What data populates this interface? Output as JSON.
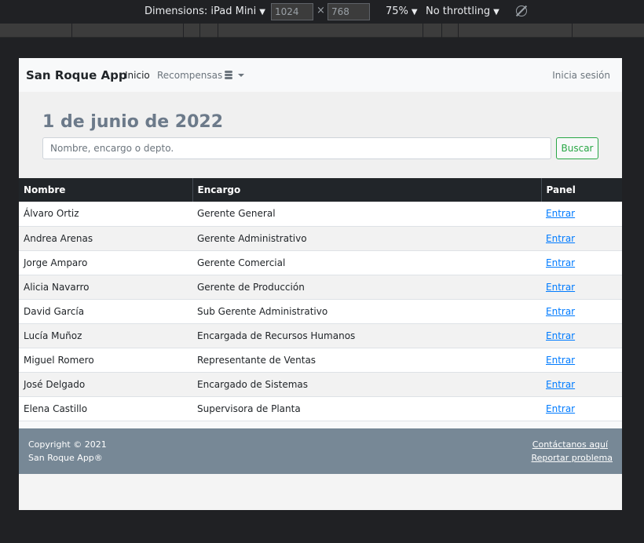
{
  "devtools": {
    "dimensions_label": "Dimensions: iPad Mini",
    "width": "1024",
    "height": "768",
    "times": "×",
    "zoom": "75%",
    "throttling": "No throttling"
  },
  "navbar": {
    "brand": "San Roque App",
    "inicio": "Inicio",
    "recompensas": "Recompensas",
    "login": "Inicia sesión"
  },
  "header": {
    "date": "1 de junio de 2022",
    "search_placeholder": "Nombre, encargo o depto.",
    "search_button": "Buscar"
  },
  "table": {
    "headers": [
      "Nombre",
      "Encargo",
      "Panel"
    ],
    "link_label": "Entrar",
    "rows": [
      {
        "nombre": "Álvaro Ortiz",
        "encargo": "Gerente General",
        "panel": "Entrar"
      },
      {
        "nombre": "Andrea Arenas",
        "encargo": "Gerente Administrativo",
        "panel": "Entrar"
      },
      {
        "nombre": "Jorge Amparo",
        "encargo": "Gerente Comercial",
        "panel": "Entrar"
      },
      {
        "nombre": "Alicia Navarro",
        "encargo": "Gerente de Producción",
        "panel": "Entrar"
      },
      {
        "nombre": "David García",
        "encargo": "Sub Gerente Administrativo",
        "panel": "Entrar"
      },
      {
        "nombre": "Lucía Muñoz",
        "encargo": "Encargada de Recursos Humanos",
        "panel": "Entrar"
      },
      {
        "nombre": "Miguel Romero",
        "encargo": "Representante de Ventas",
        "panel": "Entrar"
      },
      {
        "nombre": "José Delgado",
        "encargo": "Encargado de Sistemas",
        "panel": "Entrar"
      },
      {
        "nombre": "Elena Castillo",
        "encargo": "Supervisora de Planta",
        "panel": "Entrar"
      }
    ]
  },
  "footer": {
    "copyright": "Copyright © 2021",
    "app": "San Roque App®",
    "contact": "Contáctanos aquí",
    "report": "Reportar problema"
  },
  "colors": {
    "navbar_bg": "#f8f9fa",
    "table_header_bg": "#212529",
    "footer_bg": "#778896",
    "button_accent": "#28a745",
    "link": "#007bff"
  }
}
